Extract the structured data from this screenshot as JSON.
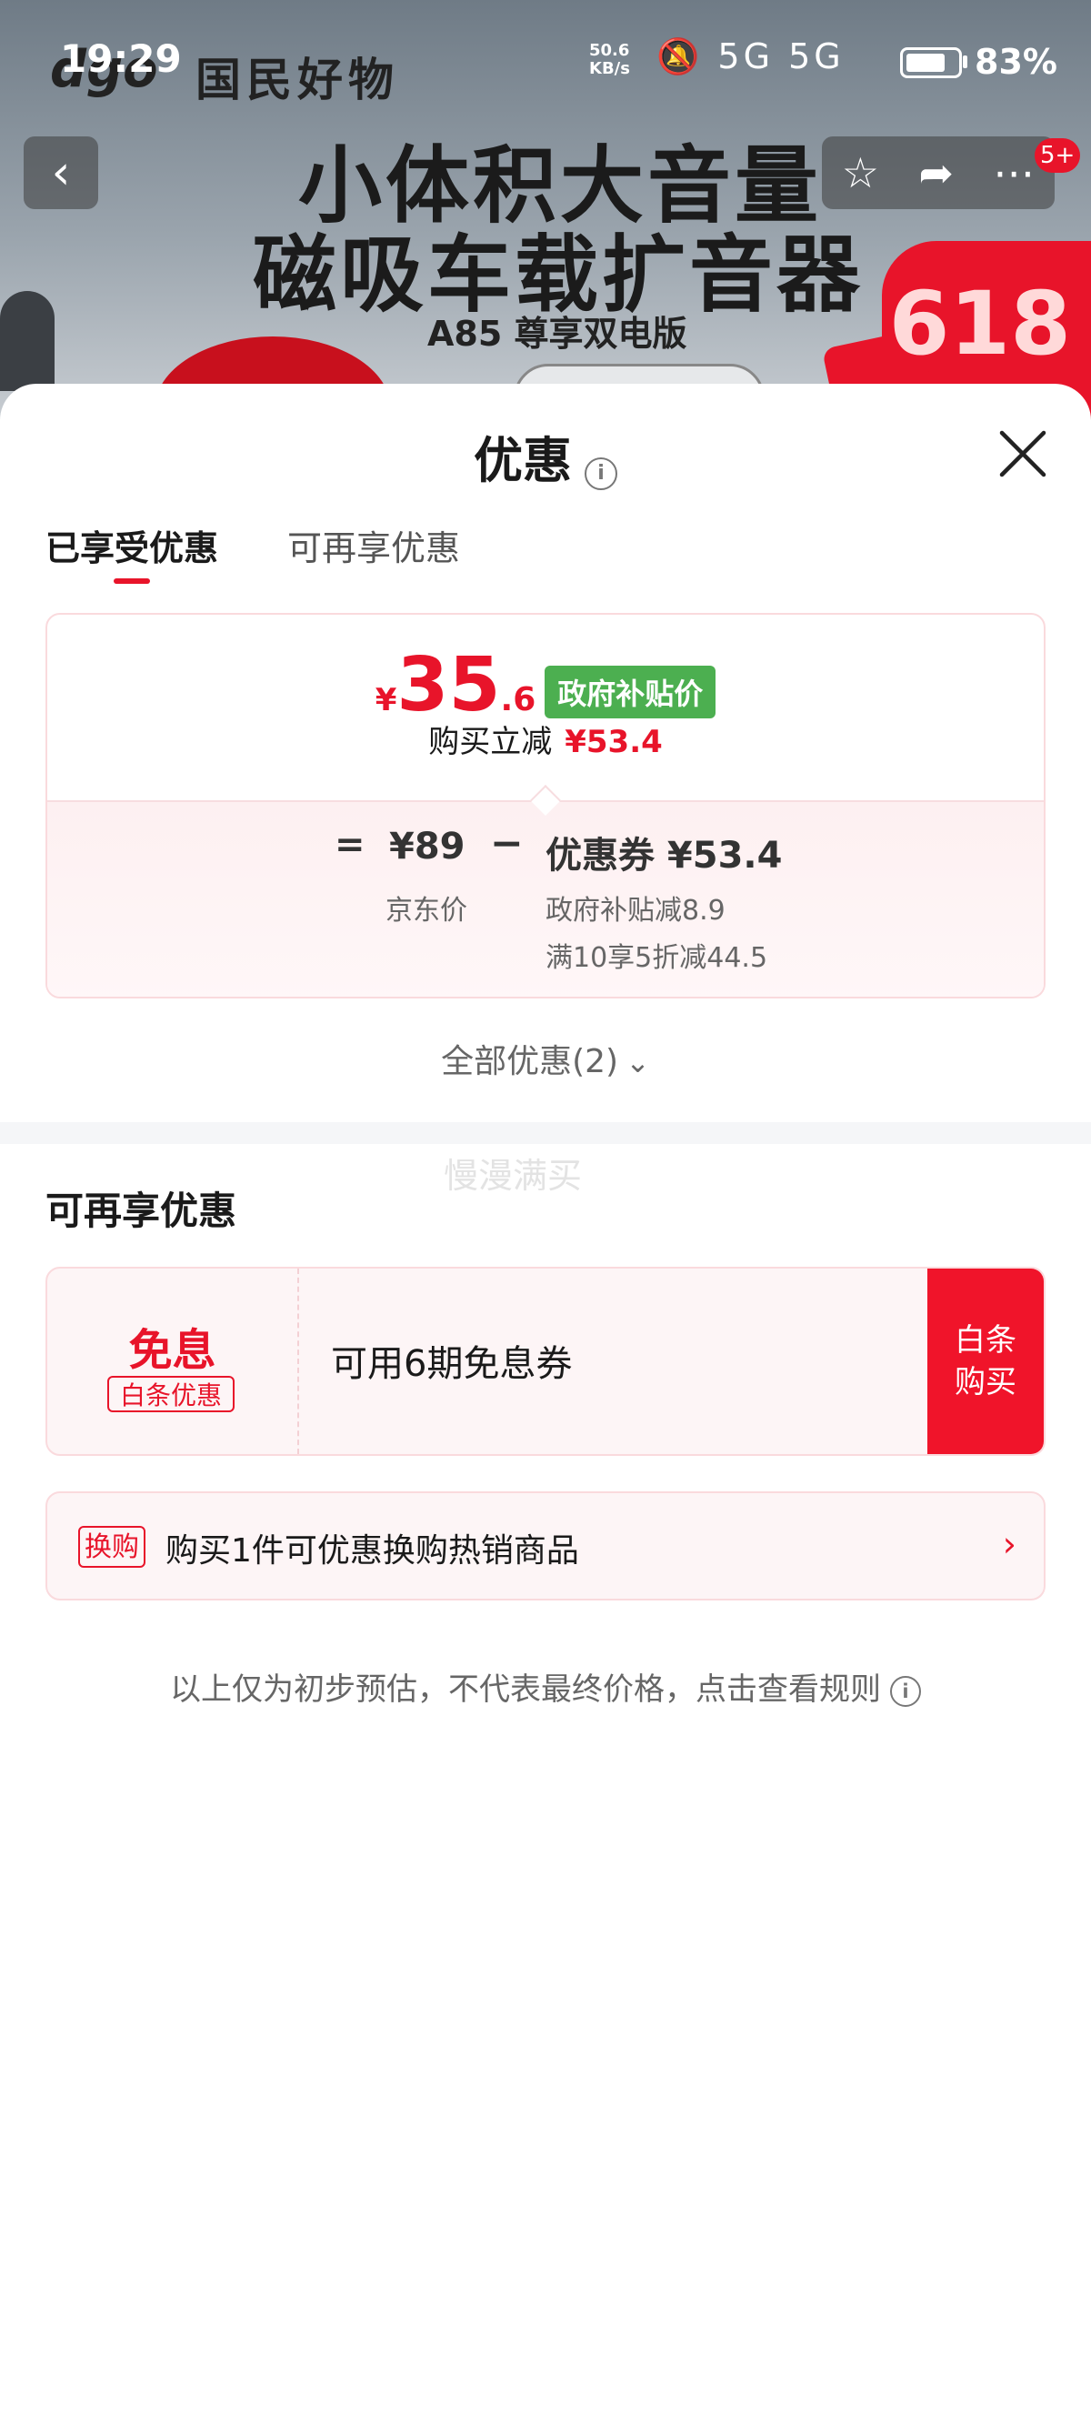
{
  "status_bar": {
    "time": "19:29",
    "net_speed_value": "50.6",
    "net_speed_unit": "KB/s",
    "signal_icons": "🔕 5G 5G",
    "battery_percent": "83%",
    "battery_level": 0.83
  },
  "banner": {
    "brand": "国民好物",
    "logo": "dgo",
    "headline_line1": "小体积大音量",
    "headline_line2": "磁吸车载扩音器",
    "model": "A85 尊享双电版",
    "promo": "618",
    "cart_badge": "5+"
  },
  "sheet": {
    "title": "优惠",
    "tabs": [
      {
        "label": "已享受优惠",
        "active": true
      },
      {
        "label": "可再享优惠",
        "active": false
      }
    ]
  },
  "price_card": {
    "currency": "¥",
    "final_price_int": "35",
    "final_price_dec": ".6",
    "gov_tag": "政府补贴价",
    "reduce_label": "购买立减",
    "reduce_amount": "¥53.4",
    "equals": "=",
    "jd_price": "¥89",
    "jd_label": "京东价",
    "minus": "−",
    "coupon": "优惠券 ¥53.4",
    "coupon_detail_1": "政府补贴减8.9",
    "coupon_detail_2": "满10享5折减44.5"
  },
  "all_discounts": "全部优惠(2)",
  "watermark": "慢漫满买",
  "more_section": {
    "title": "可再享优惠",
    "interest_free": {
      "title": "免息",
      "tag": "白条优惠",
      "description": "可用6期免息券",
      "button": "白条\n购买"
    },
    "exchange": {
      "tag": "换购",
      "text": "购买1件可优惠换购热销商品"
    }
  },
  "disclaimer": "以上仅为初步预估，不代表最终价格，点击查看规则",
  "colors": {
    "accent_red": "#e8142a",
    "gov_green": "#4caf50"
  }
}
